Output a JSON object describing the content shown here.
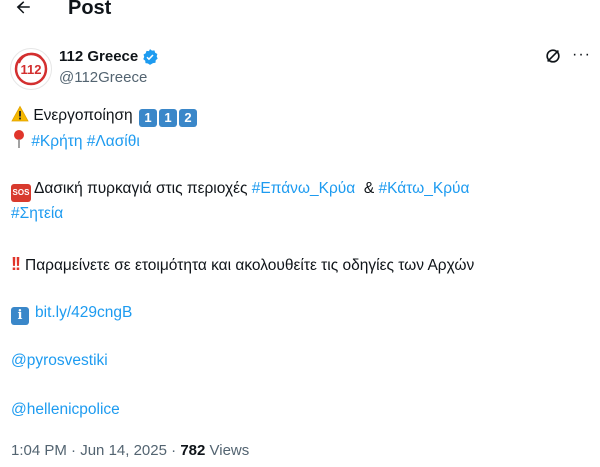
{
  "header": {
    "title": "Post"
  },
  "author": {
    "name": "112 Greece",
    "handle": "@112Greece",
    "avatar_text": "112"
  },
  "tweet": {
    "line1_text": "Ενεργοποίηση",
    "line1_keycaps": [
      "1",
      "1",
      "2"
    ],
    "line2_tags": [
      "#Κρήτη",
      "#Λασίθι"
    ],
    "line3_text": "Δασική πυρκαγιά στις περιοχές",
    "line3_tag1": "#Επάνω_Κρύα",
    "line3_amp": "&",
    "line3_tag2": "#Κάτω_Κρύα",
    "line4_tag": "#Σητεία",
    "line5_text": "Παραμείνετε σε ετοιμότητα και ακολουθείτε τις οδηγίες των Αρχών",
    "link": "bit.ly/429cngB",
    "mention1": "@pyrosvestiki",
    "mention2": "@hellenicpolice"
  },
  "icons": {
    "sos": "SOS",
    "info": "i",
    "bang": "!!"
  },
  "meta": {
    "time": "1:04 PM",
    "sep1": "·",
    "date": "Jun 14, 2025",
    "sep2": "·",
    "views_count": "782",
    "views_label": "Views"
  },
  "colors": {
    "link": "#1d9bf0",
    "verified": "#1d9bf0",
    "muted": "#536471"
  }
}
